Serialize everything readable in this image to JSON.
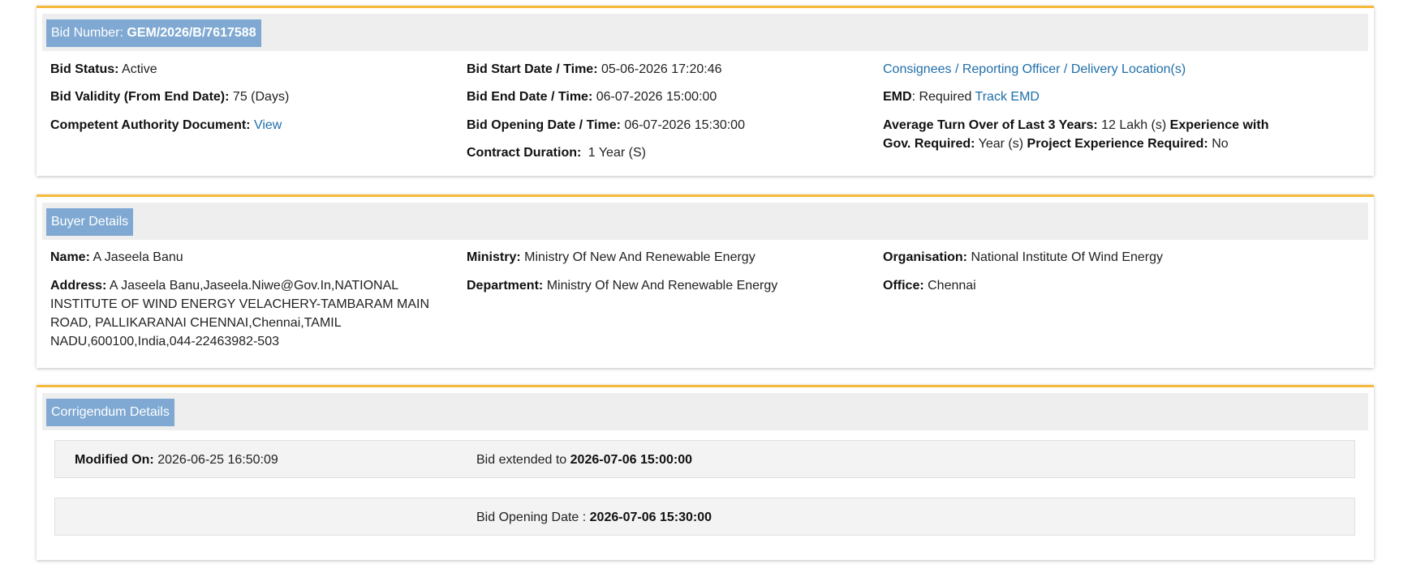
{
  "bid_panel": {
    "tag_label": "Bid Number:",
    "tag_value": "GEM/2026/B/7617588",
    "bid_status_label": "Bid Status:",
    "bid_status_value": "Active",
    "bid_validity_label": "Bid Validity (From End Date):",
    "bid_validity_value": "75 (Days)",
    "competent_label": "Competent Authority Document:",
    "competent_link": "View",
    "start_label": "Bid Start Date / Time:",
    "start_value": "05-06-2026 17:20:46",
    "end_label": "Bid End Date / Time:",
    "end_value": "06-07-2026 15:00:00",
    "opening_label": "Bid Opening Date / Time:",
    "opening_value": "06-07-2026 15:30:00",
    "contract_label": "Contract Duration:",
    "contract_value": "1 Year (S)",
    "consignees_link": "Consignees / Reporting Officer / Delivery Location(s)",
    "emd_label": "EMD",
    "emd_value": ": Required",
    "emd_link": "Track EMD",
    "turnover_label": "Average Turn Over of Last 3 Years:",
    "turnover_value": "12 Lakh (s)",
    "experience_label_a": "Experience with",
    "experience_label_b": "Gov. Required:",
    "experience_value": "Year (s)",
    "project_label": "Project Experience Required:",
    "project_value": "No"
  },
  "buyer_panel": {
    "tag_label": "Buyer Details",
    "name_label": "Name:",
    "name_value": "A Jaseela Banu",
    "address_label": "Address:",
    "address_line1": "A Jaseela Banu,Jaseela.Niwe@Gov.In,NATIONAL",
    "address_line2": "INSTITUTE OF WIND ENERGY VELACHERY-TAMBARAM MAIN",
    "address_line3": "ROAD, PALLIKARANAI CHENNAI,Chennai,TAMIL",
    "address_line4": "NADU,600100,India,044-22463982-503",
    "ministry_label": "Ministry:",
    "ministry_value": "Ministry Of New And Renewable Energy",
    "department_label": "Department:",
    "department_value": "Ministry Of New And Renewable Energy",
    "organisation_label": "Organisation:",
    "organisation_value": "National Institute Of Wind Energy",
    "office_label": "Office:",
    "office_value": "Chennai"
  },
  "corrigendum_panel": {
    "tag_label": "Corrigendum Details",
    "modified_label": "Modified On:",
    "modified_value": "2026-06-25 16:50:09",
    "extended_text": "Bid extended to",
    "extended_value": "2026-07-06 15:00:00",
    "opening_text": "Bid Opening Date :",
    "opening_value": "2026-07-06 15:30:00"
  },
  "colors": {
    "accent_border": "#f6b93b",
    "tag_bg": "#7fa9d3",
    "link": "#1f6ea8"
  }
}
